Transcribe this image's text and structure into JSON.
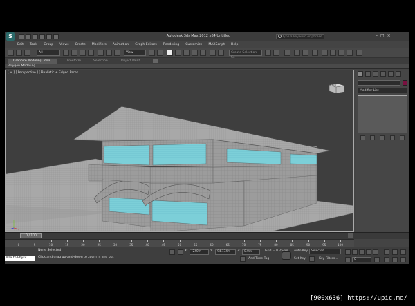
{
  "app": {
    "logo": "S",
    "title": "Autodesk 3ds Max 2012 x64    Untitled",
    "search_placeholder": "Type a keyword or phrase",
    "window_controls": [
      "–",
      "□",
      "×"
    ]
  },
  "menu": [
    "Edit",
    "Tools",
    "Group",
    "Views",
    "Create",
    "Modifiers",
    "Animation",
    "Graph Editors",
    "Rendering",
    "Customize",
    "MAXScript",
    "Help"
  ],
  "toolbar": {
    "filter_value": "All",
    "refcoord_value": "View",
    "selection_set_placeholder": "Create Selection Se"
  },
  "ribbon": {
    "tabs": [
      "Graphite Modeling Tools",
      "Freeform",
      "Selection",
      "Object Paint"
    ],
    "sub_label": "Polygon Modeling"
  },
  "viewport": {
    "label": "[ + ] [ Perspective ] [ Realistic + Edged Faces ]",
    "viewcube_face": "LEFT"
  },
  "command_panel": {
    "modifier_list": "Modifier List"
  },
  "timeline": {
    "slider_label": "0 / 100",
    "ticks": [
      "0",
      "5",
      "10",
      "15",
      "20",
      "25",
      "30",
      "35",
      "40",
      "45",
      "50",
      "55",
      "60",
      "65",
      "70",
      "75",
      "80",
      "85",
      "90",
      "95",
      "100"
    ]
  },
  "status": {
    "maxscript": "Max to Physc",
    "selection": "None Selected",
    "hint": "Click and drag up-and-down to zoom in and out",
    "x_field": "-240m",
    "y_field": "94.134m",
    "z_field": "0.0m",
    "grid_label": "Grid = 0.254m",
    "add_time_tag": "Add Time Tag",
    "auto_key": "Auto Key",
    "selected": "Selected",
    "set_key": "Set Key",
    "key_filters": "Key Filters...",
    "frame_value": "0"
  },
  "watermark": "[900x636] https://upic.me/"
}
